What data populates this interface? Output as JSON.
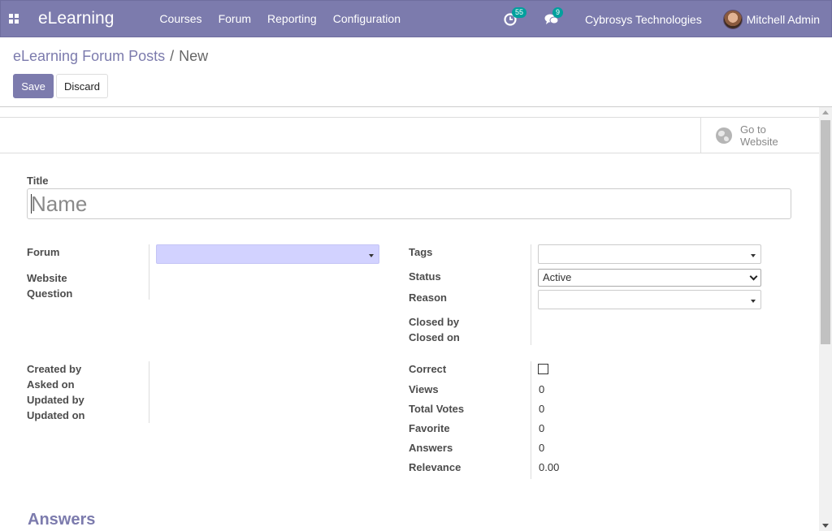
{
  "app": {
    "name": "eLearning"
  },
  "menu": [
    "Courses",
    "Forum",
    "Reporting",
    "Configuration"
  ],
  "systray": {
    "activity_count": "55",
    "messages_count": "9",
    "company": "Cybrosys Technologies",
    "user": "Mitchell Admin"
  },
  "breadcrumb": {
    "parent": "eLearning Forum Posts",
    "separator": "/",
    "current": "New"
  },
  "buttons": {
    "save": "Save",
    "discard": "Discard"
  },
  "button_box": {
    "website": "Go to Website"
  },
  "form": {
    "title_label": "Title",
    "title_placeholder": "Name",
    "left": {
      "forum_label": "Forum",
      "forum_value": "",
      "website_question_label": "Website Question",
      "created_by_label": "Created by",
      "asked_on_label": "Asked on",
      "updated_by_label": "Updated by",
      "updated_on_label": "Updated on"
    },
    "right": {
      "tags_label": "Tags",
      "status_label": "Status",
      "status_value": "Active",
      "reason_label": "Reason",
      "closed_by_label": "Closed by",
      "closed_on_label": "Closed on",
      "correct_label": "Correct",
      "correct_checked": false,
      "views_label": "Views",
      "views_value": "0",
      "total_votes_label": "Total Votes",
      "total_votes_value": "0",
      "favorite_label": "Favorite",
      "favorite_value": "0",
      "answers_label": "Answers",
      "answers_value": "0",
      "relevance_label": "Relevance",
      "relevance_value": "0.00"
    },
    "answers_section_title": "Answers"
  },
  "colors": {
    "brand": "#7c7bad",
    "badge": "#00a09d",
    "required_field": "#d2d2ff"
  },
  "icons": [
    "apps-grid-icon",
    "activity-clock-icon",
    "chat-bubbles-icon",
    "user-avatar",
    "globe-icon",
    "chevron-down-icon"
  ]
}
